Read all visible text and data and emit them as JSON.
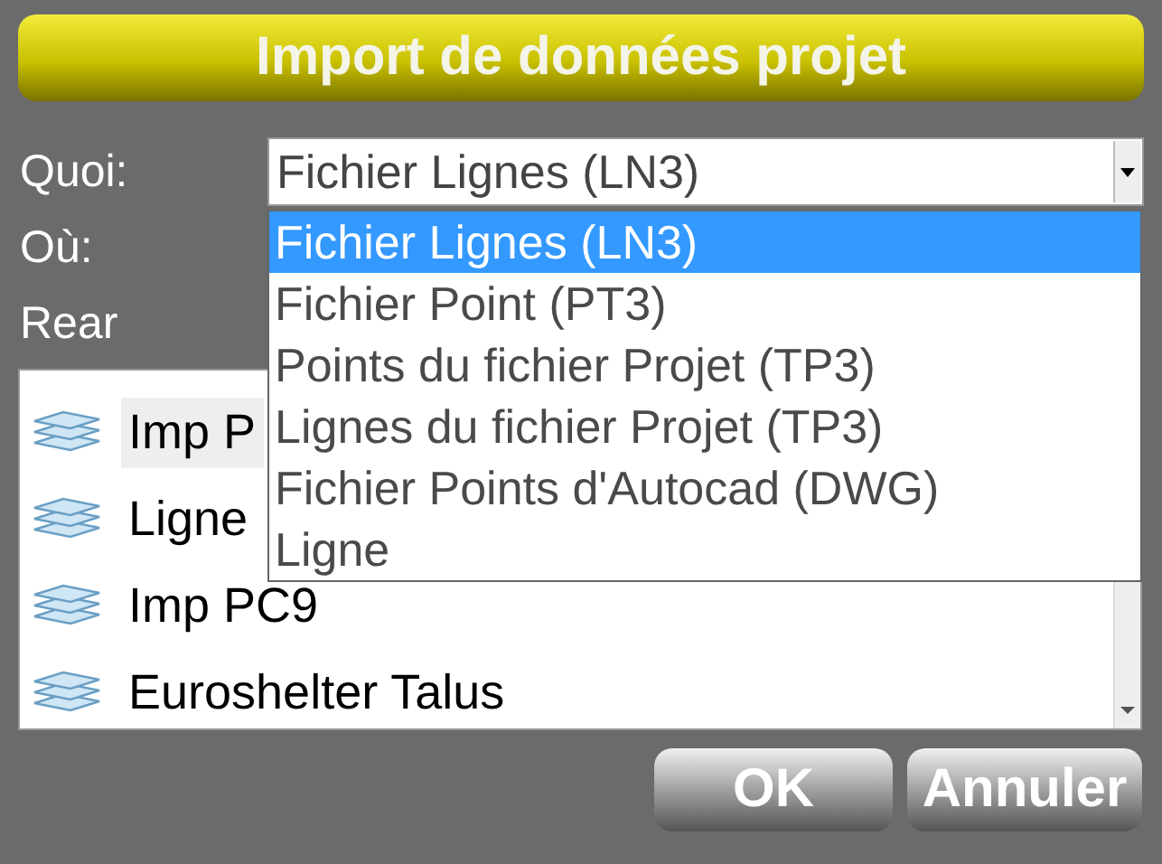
{
  "title": "Import de données projet",
  "fields": [
    {
      "label": "Quoi:",
      "value": "Fichier Lignes (LN3)"
    },
    {
      "label": "Où:"
    },
    {
      "label": "Rear"
    }
  ],
  "dropdown": {
    "options": [
      {
        "label": "Fichier Lignes (LN3)",
        "selected": true
      },
      {
        "label": "Fichier Point (PT3)",
        "selected": false
      },
      {
        "label": "Points du fichier Projet (TP3)",
        "selected": false
      },
      {
        "label": "Lignes du fichier Projet (TP3)",
        "selected": false
      },
      {
        "label": "Fichier Points d'Autocad (DWG)",
        "selected": false
      },
      {
        "label": "Ligne",
        "selected": false
      }
    ]
  },
  "list": {
    "items": [
      {
        "label": "Imp P",
        "selected": true
      },
      {
        "label": "Ligne",
        "selected": false
      },
      {
        "label": "Imp PC9",
        "selected": false
      },
      {
        "label": "Euroshelter Talus",
        "selected": false
      }
    ]
  },
  "buttons": [
    "OK",
    "Annuler"
  ]
}
